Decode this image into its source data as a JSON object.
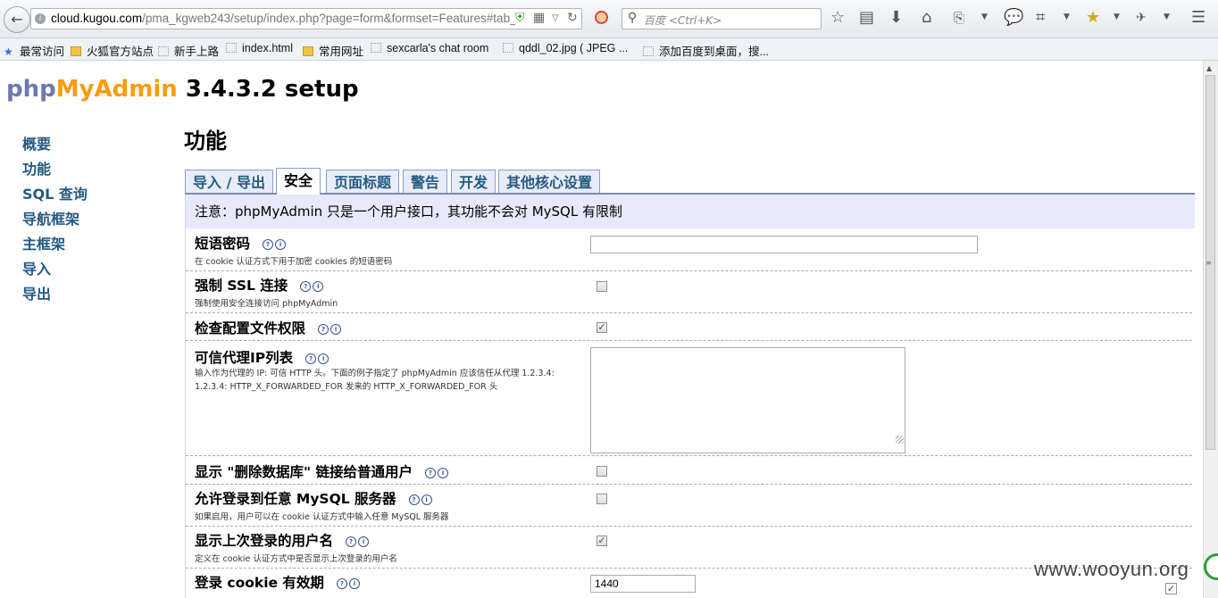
{
  "browser": {
    "back_label": "←",
    "url_domain": "cloud.kugou.com",
    "url_path": "/pma_kgweb243/setup/index.php?page=form&formset=Features#tab_",
    "search_placeholder": "百度 <Ctrl+K>",
    "bookmarks": [
      "最常访问",
      "火狐官方站点",
      "新手上路",
      "index.html",
      "常用网址",
      "sexcarla's chat room",
      "qddl_02.jpg ( JPEG ...",
      "添加百度到桌面，搜..."
    ]
  },
  "icons": {
    "search": "search-icon",
    "star": "star-icon",
    "refresh": "refresh-icon",
    "home": "home-icon",
    "download": "download-icon",
    "chat": "chat-bubble-icon",
    "menu": "hamburger-icon"
  },
  "colors": {
    "php": "#6c78af",
    "myadmin": "#f89c0e",
    "menu_link": "#235a81",
    "notice_bg": "#e7e9fb"
  },
  "logo": {
    "php": "php",
    "myadmin": "MyAdmin",
    "version": " 3.4.3.2 setup"
  },
  "menu": [
    "概要",
    "功能",
    "SQL 查询",
    "导航框架",
    "主框架",
    "导入",
    "导出"
  ],
  "page_title": "功能",
  "tabs": [
    "导入 / 导出",
    "安全",
    "页面标题",
    "警告",
    "开发",
    "其他核心设置"
  ],
  "active_tab": "安全",
  "notice": "注意：phpMyAdmin 只是一个用户接口，其功能不会对 MySQL 有限制",
  "fields": {
    "blowfish": {
      "label": "短语密码",
      "desc": "在 cookie 认证方式下用于加密 cookies 的短语密码",
      "value": ""
    },
    "force_ssl": {
      "label": "强制 SSL 连接",
      "desc": "强制使用安全连接访问 phpMyAdmin",
      "checked": false
    },
    "check_perms": {
      "label": "检查配置文件权限",
      "checked": true
    },
    "trusted_proxies": {
      "label": "可信代理IP列表",
      "desc": "输入作为代理的 IP: 可信 HTTP 头。下面的例子指定了 phpMyAdmin 应该信任从代理 1.2.3.4: 1.2.3.4: HTTP_X_FORWARDED_FOR 发来的 HTTP_X_FORWARDED_FOR 头",
      "value": ""
    },
    "show_drop_db": {
      "label": "显示 \"删除数据库\" 链接给普通用户",
      "checked": false
    },
    "allow_arbitrary_server": {
      "label": "允许登录到任意 MySQL 服务器",
      "desc": "如果启用，用户可以在 cookie 认证方式中输入任意 MySQL 服务器",
      "checked": false
    },
    "remember_username": {
      "label": "显示上次登录的用户名",
      "desc": "定义在 cookie 认证方式中是否显示上次登录的用户名",
      "checked": true
    },
    "login_cookie_validity": {
      "label": "登录 cookie 有效期",
      "value": "1440"
    }
  },
  "watermark": "www.wooyun.org"
}
